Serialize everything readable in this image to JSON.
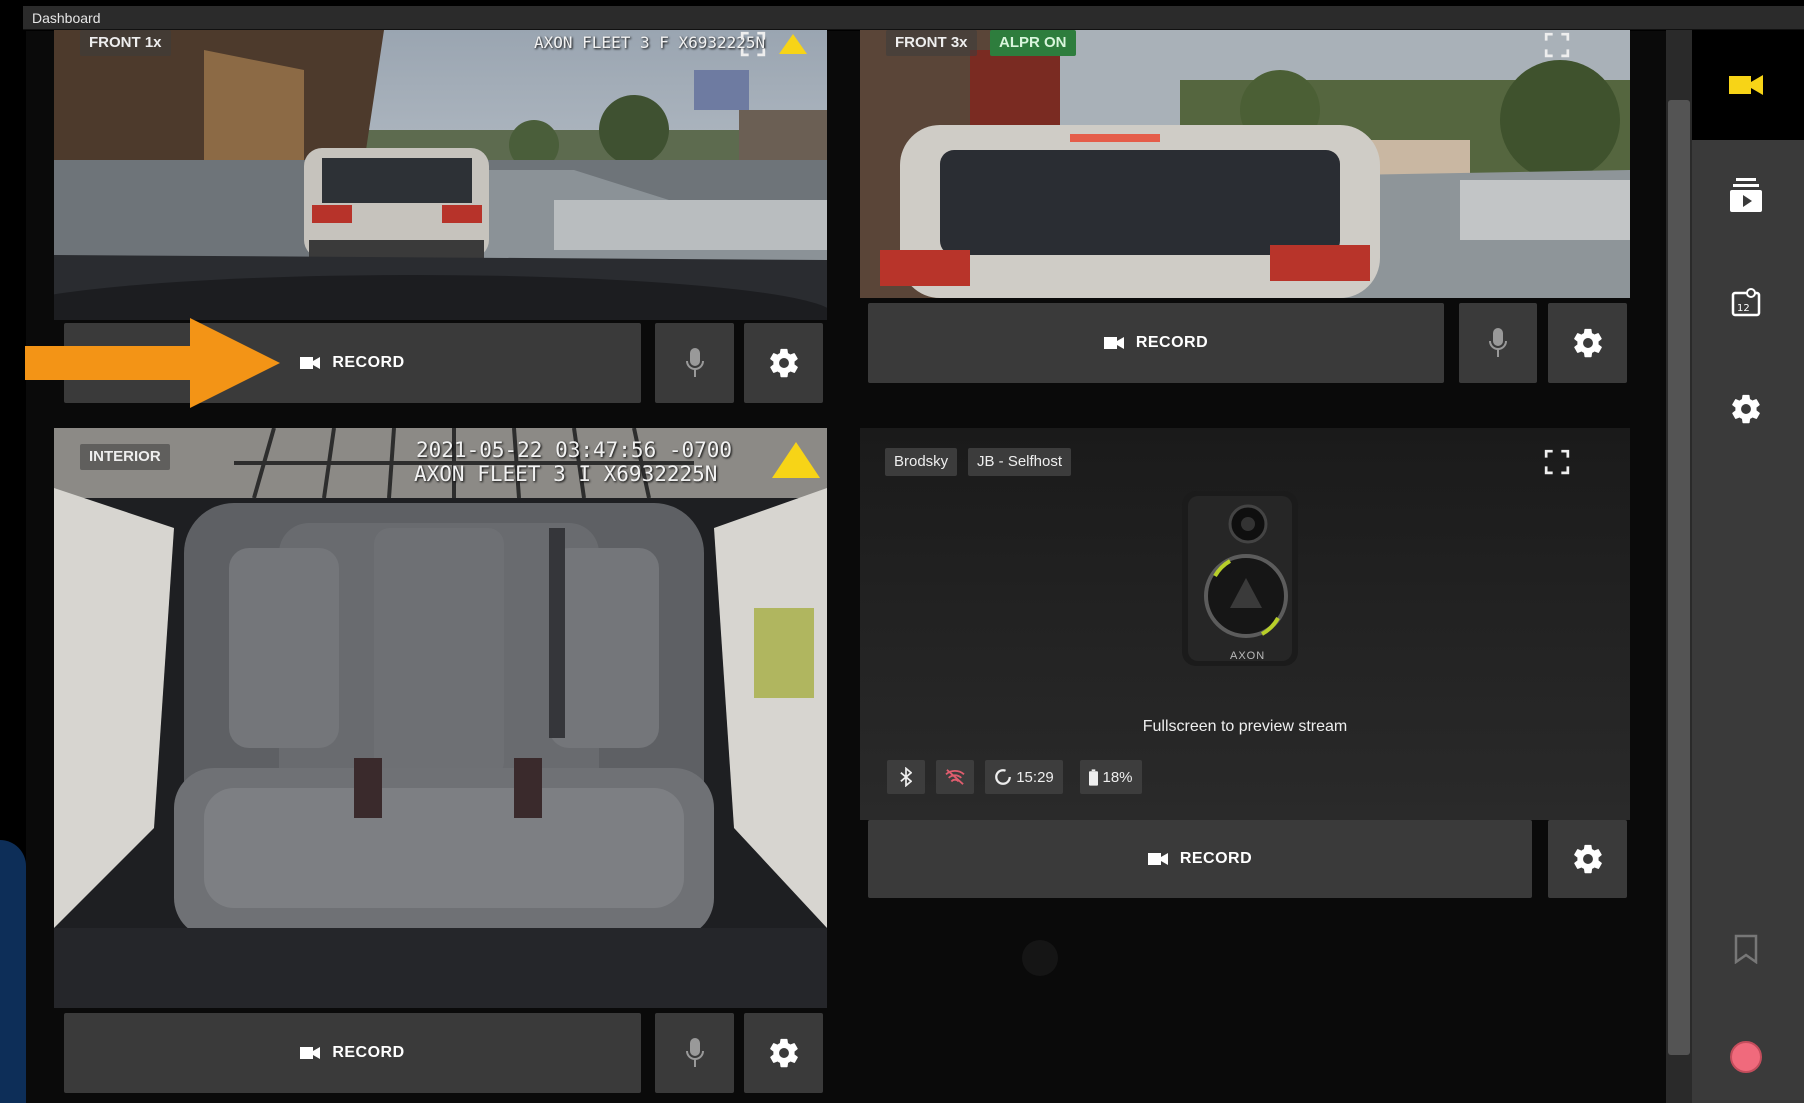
{
  "window": {
    "title": "Dashboard"
  },
  "colors": {
    "accent": "#f7d417",
    "arrow": "#f39416",
    "alpr_green": "#2e7d3d",
    "record_dot": "#f06a7c"
  },
  "cameras": {
    "front1x": {
      "label": "FRONT 1x",
      "overlay": "AXON FLEET 3 F X6932225N",
      "record_label": "RECORD"
    },
    "front3x": {
      "label": "FRONT 3x",
      "alpr": "ALPR ON",
      "record_label": "RECORD"
    },
    "interior": {
      "label": "INTERIOR",
      "overlay_line1": "2021-05-22 03:47:56 -0700",
      "overlay_line2": "AXON FLEET 3 I X6932225N",
      "record_label": "RECORD"
    }
  },
  "bodycam": {
    "tags": [
      "Brodsky",
      "JB - Selfhost"
    ],
    "device_logo": "AXON",
    "preview_text": "Fullscreen to preview stream",
    "status": {
      "bluetooth_icon": "bluetooth-icon",
      "wifi_icon": "wifi-off-icon",
      "time": "15:29",
      "battery": "18%"
    },
    "record_label": "RECORD"
  },
  "rail": {
    "items": [
      "camera-icon",
      "playback-icon",
      "evidence-icon",
      "settings-icon",
      "bookmark-icon",
      "record-indicator-icon"
    ]
  }
}
